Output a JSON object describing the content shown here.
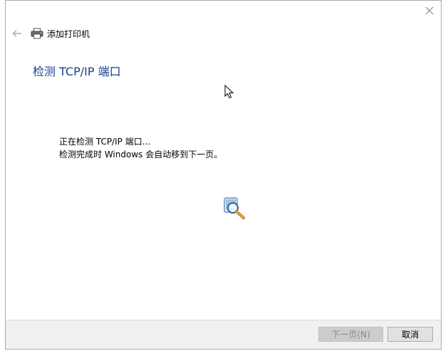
{
  "window": {
    "nav_title": "添加打印机",
    "heading": "检测 TCP/IP 端口",
    "status_line1": "正在检测 TCP/IP 端口...",
    "status_line2": "检测完成时 Windows 会自动移到下一页。"
  },
  "footer": {
    "next_label": "下一页(N)",
    "cancel_label": "取消"
  },
  "icons": {
    "close": "close-icon",
    "back": "back-arrow-icon",
    "printer": "printer-icon",
    "search": "magnifier-search-icon",
    "cursor": "mouse-cursor-icon"
  },
  "colors": {
    "heading": "#1a3e8c",
    "footer_bg": "#f0f0f0",
    "disabled_button_text": "#8a8a8a"
  }
}
